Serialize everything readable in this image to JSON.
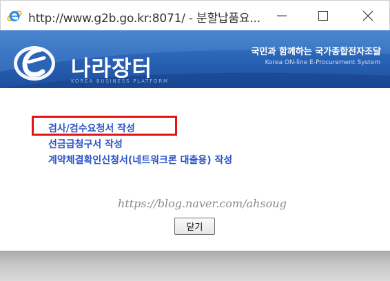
{
  "window": {
    "title": "http://www.g2b.go.kr:8071/ - 분할납품요..."
  },
  "banner": {
    "brand_name": "나라장터",
    "brand_sub": "KOREA BUSINESS PLATFORM",
    "slogan": "국민과 함께하는 국가종합전자조달",
    "slogan_en": "Korea ON-line E-Procurement System"
  },
  "links": [
    {
      "label": "검사/검수요청서 작성"
    },
    {
      "label": "선금급청구서 작성"
    },
    {
      "label": "계약체결확인신청서(네트워크론 대출용) 작성"
    }
  ],
  "watermark": "https://blog.naver.com/ahsoug",
  "close_button": "닫기",
  "colors": {
    "link": "#2a55c8",
    "highlight": "#e01414",
    "banner": "#2a64b7"
  }
}
